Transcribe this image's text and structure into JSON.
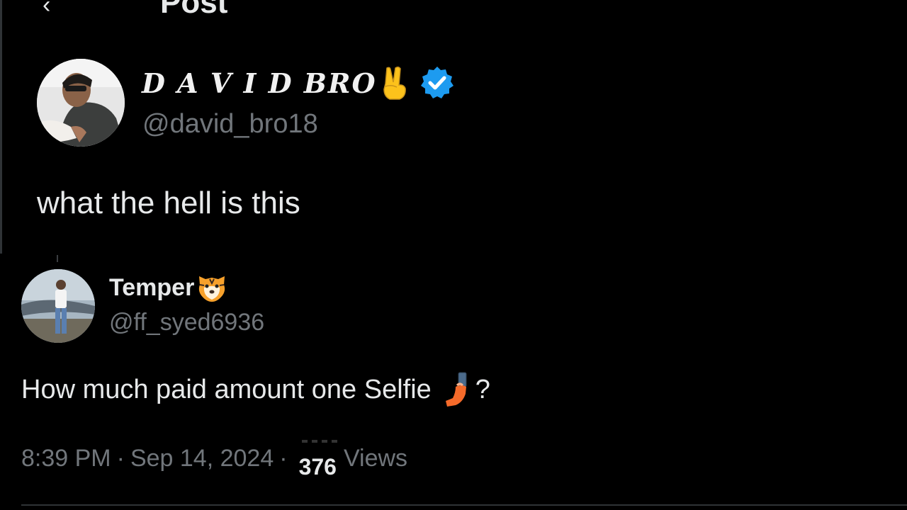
{
  "header": {
    "back_glyph": "‹",
    "title": "Post"
  },
  "original_post": {
    "display_name": "D A V I D BRO",
    "handle": "@david_bro18",
    "text": "what the hell is this",
    "icons": [
      "avatar",
      "victory-hand-emoji-icon",
      "verified-badge-icon"
    ],
    "verified_color": "#1d9bf0"
  },
  "reply": {
    "display_name": "Temper",
    "handle": "@ff_syed6936",
    "text": "How much paid amount one Selfie",
    "text_suffix": "?",
    "icons": [
      "avatar",
      "tiger-face-emoji-icon",
      "selfie-emoji-icon"
    ]
  },
  "meta": {
    "time": "8:39 PM",
    "separator": "·",
    "date": "Sep 14, 2024",
    "views_count": "376",
    "views_label": "Views"
  },
  "colors": {
    "background": "#000000",
    "primary_text": "#e7e9ea",
    "secondary_text": "#71767b",
    "divider": "#2f3336"
  }
}
